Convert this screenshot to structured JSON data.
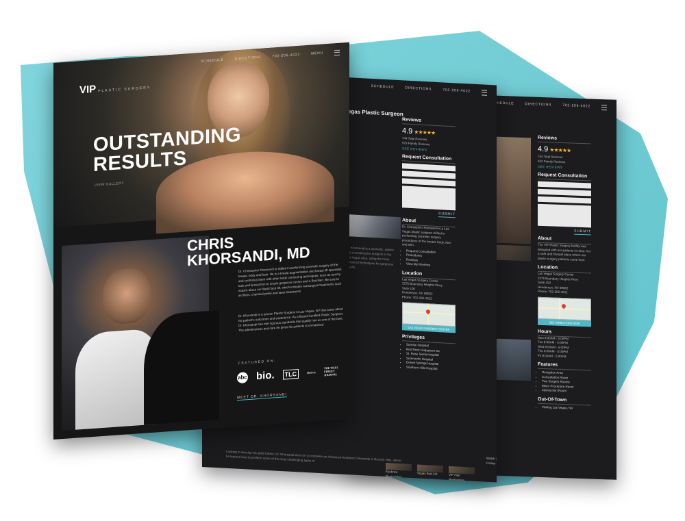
{
  "colors": {
    "background_shape": "#7fd2d9",
    "page_dark": "#1b1b1d",
    "accent": "#44b8c8",
    "star": "#f3b229"
  },
  "page_back": {
    "nav": [
      "SCHEDULE",
      "DIRECTIONS",
      "702-206-4022"
    ],
    "sidebar": {
      "reviews_title": "Reviews",
      "rating": "4.9",
      "total_reviews": "744 Total Reviews",
      "family_reviews": "452 Family Reviews",
      "see_all": "SEE REVIEWS",
      "request_title": "Request Consultation",
      "submit": "SUBMIT",
      "about_title": "About",
      "about_text": "The VIP Plastic Surgery facility was designed with our patients in mind. It is a safe and tranquil place where our plastic surgery patients come from",
      "location_title": "Location",
      "address_lines": [
        "Las Vegas Surgery Center",
        "2275 Boundary Heights Pkwy",
        "Suite 100",
        "Henderson, NV 89052",
        "Phone: 702-206-4022"
      ],
      "map_button": "GET DIRECTIONS NOW",
      "hours_title": "Hours",
      "hours": [
        "Mon 8:00AM - 5:00PM",
        "Tue 8:00AM - 5:00PM",
        "Wed 8:00AM - 5:00PM",
        "Thu 8:00AM - 5:00PM",
        "Fri 8:00AM - 5:00PM"
      ],
      "features_title": "Features",
      "features": [
        "Reception Area",
        "Consultation Room",
        "Two Surgery Rooms",
        "Minor Procedure Room",
        "Liposuction Room"
      ],
      "out_of_town_title": "Out-Of-Town",
      "out_of_town": [
        "Visiting Las Vegas, NV"
      ]
    }
  },
  "page_middle": {
    "nav": [
      "SCHEDULE",
      "DIRECTIONS",
      "702-206-4022"
    ],
    "heading": "Vegas Plastic Surgeon",
    "sidebar": {
      "reviews_title": "Reviews",
      "rating": "4.9",
      "total_reviews": "744 Total Reviews",
      "family_reviews": "579 Family Reviews",
      "see_all": "SEE REVIEWS",
      "request_title": "Request Consultation",
      "submit": "SUBMIT",
      "about_title": "About",
      "about_text": "Dr. Christopher Khorsandi is a Las Vegas plastic surgeon skilled in performing cosmetic surgery procedures of the breast, body, face and skin.",
      "about_list": [
        "Request Consultation",
        "Procedures",
        "Reviews",
        "View My Reviews"
      ],
      "location_title": "Location",
      "address_lines": [
        "Las Vegas Surgery Center",
        "2275 Boundary Heights Pkwy",
        "Suite 100",
        "Henderson, NV 89052",
        "Phone: 702-206-4022"
      ],
      "map_button": "LAS VEGAS SURGERY CENTER",
      "privileges_title": "Privileges",
      "privileges": [
        "Sunrise Hospital",
        "Red Rock Outpatient SC",
        "St. Rose Siena Hospital",
        "Summerlin Hospital",
        "Desert Springs Hospital",
        "Southern Hills Hospital"
      ]
    },
    "bottom_captions": [
      "Eyebrow Restoration",
      "Vegas Butt Lift",
      "VIP Hair Restoration"
    ],
    "bottom_text": "Watch 3 Las Vegas Surgery Center Videos",
    "body_text": "Looking to develop his skills further, Dr. Khorsandi went on to complete an Advanced Aesthetic Fellowship in Beverly Hills, where he learned how to perform some of the most challenging types of"
  },
  "page_front": {
    "logo": "VIP",
    "logo_sub": "PLASTIC SURGERY",
    "nav": [
      "SCHEDULE",
      "DIRECTIONS",
      "702-206-4022",
      "MENU"
    ],
    "hero_title": "OUTSTANDING RESULTS",
    "hero_link": "VIEW GALLERY",
    "doctor_name": "CHRIS KHORSANDI, MD",
    "bio_1": "Dr. Christopher Khorsandi is skilled in performing cosmetic surgery of the breast, body and face. He is a breast augmentation and breast lift specialist, and combines them with other body contouring techniques, such as tummy tuck and liposuction to create gorgeous curves and a Brazilian. Be sure to inquire about our liquid face lift, which includes nonsurgical treatments such as fillers, chemical peels and laser treatments.",
    "bio_2": "Dr. Khorsandi is a proven Plastic Surgeon in Las Vegas, NV that cares about his patient's outcomes and experience. As a Board-Certified Plastic Surgeon, Dr. Khorsandi has met rigorous standards that qualify him as one of the best. The attentiveness and care he gives his patients is unmatched",
    "featured_label": "FEATURED ON:",
    "featured_logos": [
      "abc",
      "bio.",
      "TLC",
      "lifetime",
      "THE WALL STREET JOURNAL"
    ],
    "meet_link": "MEET DR. KHORSANDI"
  }
}
